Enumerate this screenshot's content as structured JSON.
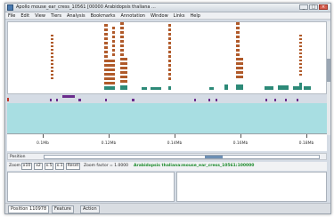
{
  "window": {
    "title": "Apollo  mouse_ear_cress_10561 [00000 Arabidopsis thaliana ..."
  },
  "menu": [
    "File",
    "Edit",
    "View",
    "Tiers",
    "Analysis",
    "Bookmarks",
    "Annotation",
    "Window",
    "Links",
    "Help"
  ],
  "axis": {
    "ticks": [
      "0.1Mb",
      "0.12Mb",
      "0.14Mb",
      "0.16Mb",
      "0.18Mb"
    ]
  },
  "position": {
    "label": "Position"
  },
  "zoom": {
    "label": "Zoom",
    "buttons": [
      "x10",
      "x2",
      "x.5",
      "x.1",
      "Reset"
    ],
    "factor_text": "Zoom factor = 1.0000",
    "region_text": "Arabidopsis thaliana:mouse_ear_cress_10561:100000"
  },
  "status": {
    "tabs": [
      "Position 110978",
      "Feature",
      "Action"
    ]
  },
  "colors": {
    "feature": "#b05a2a",
    "gene": "#2d8a78",
    "annot": "#6a2c8c",
    "band": "#a8dee2"
  }
}
